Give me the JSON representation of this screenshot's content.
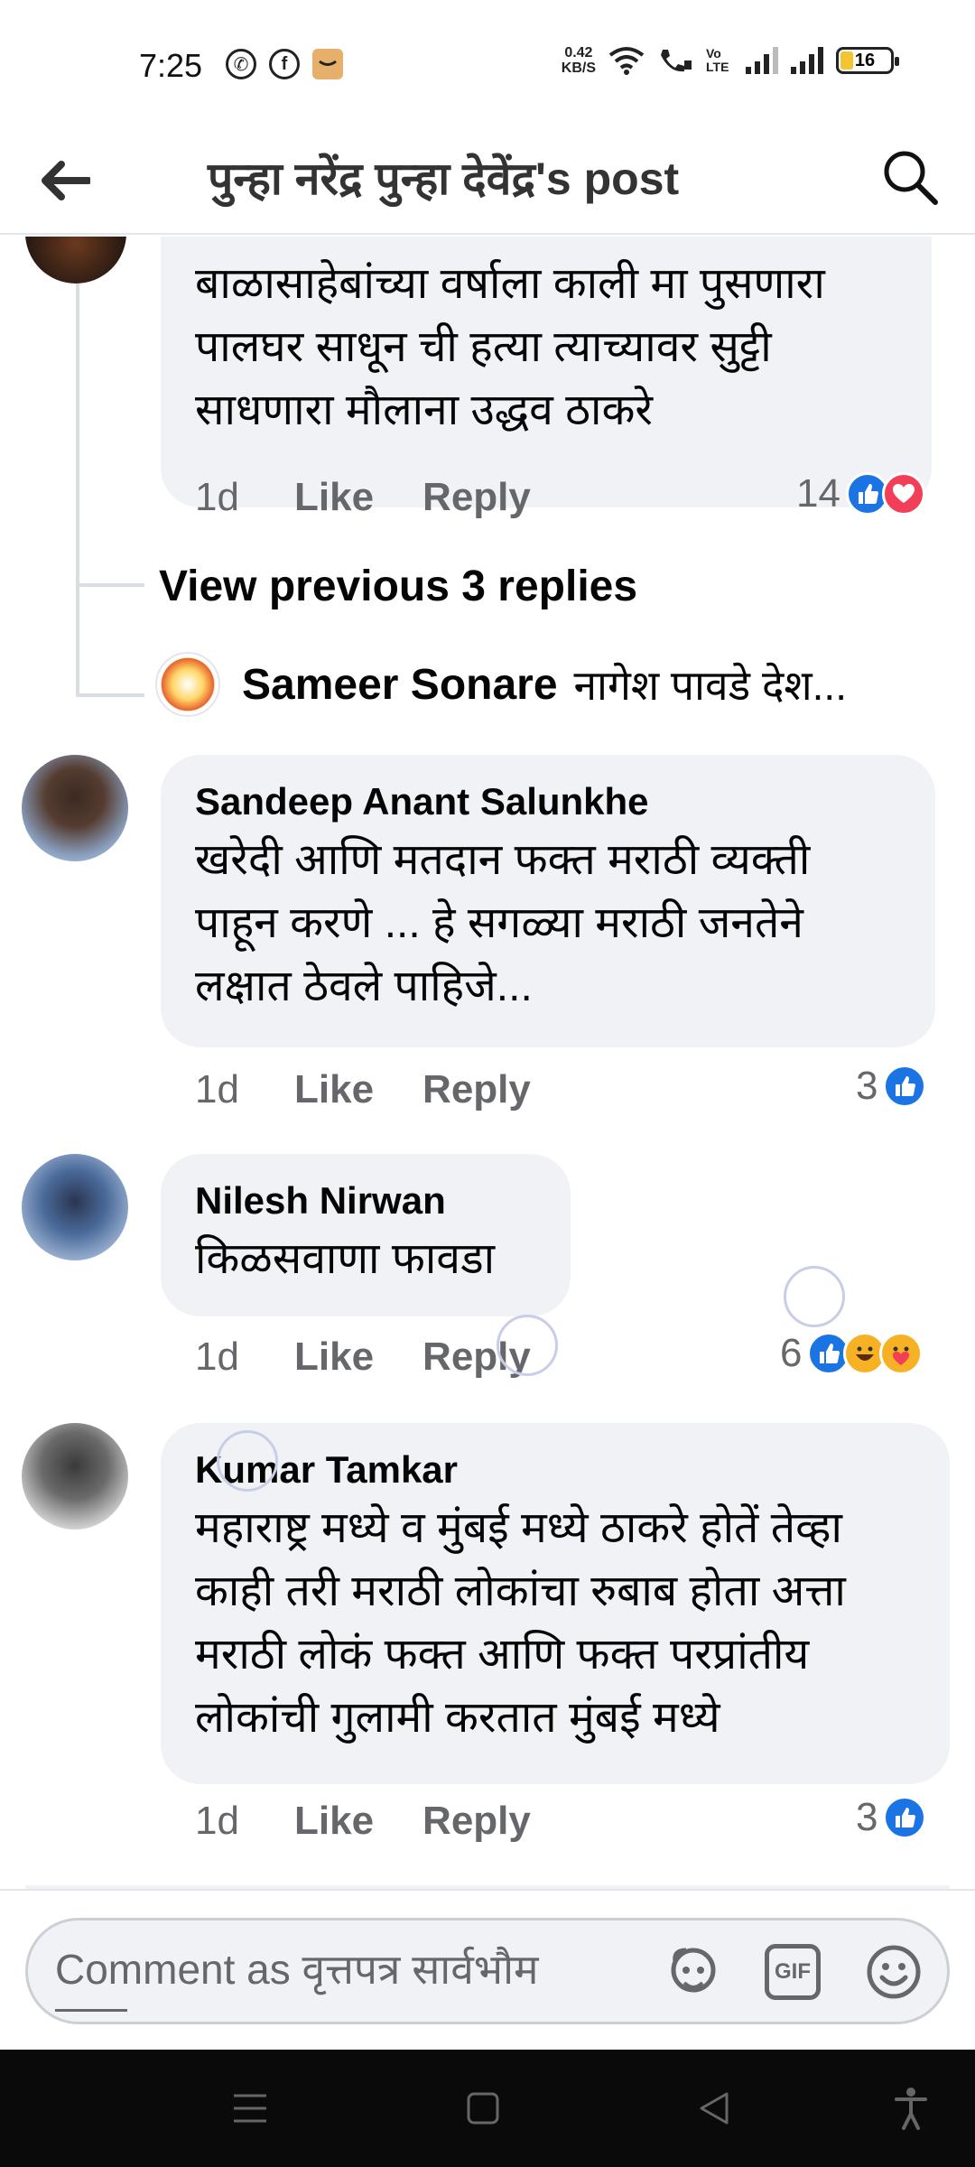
{
  "status_bar": {
    "time": "7:25",
    "app_icons": [
      "whatsapp-icon",
      "facebook-icon",
      "amazon-icon"
    ],
    "net_speed_value": "0.42",
    "net_speed_unit": "KB/S",
    "volte_label": "Vo LTE",
    "battery": "16"
  },
  "header": {
    "title": "पुन्हा नरेंद्र पुन्हा देवेंद्र's post"
  },
  "comments": [
    {
      "text": "बाळासाहेबांच्या वर्षाला काली मा पुसणारा पालघर साधून ची हत्या त्याच्यावर सुट्टी साधणारा मौलाना उद्धव ठाकरे",
      "time": "1d",
      "like_label": "Like",
      "reply_label": "Reply",
      "reaction_count": "14"
    },
    {
      "author": "Sandeep Anant Salunkhe",
      "text": "खरेदी आणि मतदान फक्त मराठी व्यक्ती पाहून करणे ... हे सगळ्या मराठी जनतेने लक्षात ठेवले पाहिजे...",
      "time": "1d",
      "like_label": "Like",
      "reply_label": "Reply",
      "reaction_count": "3"
    },
    {
      "author": "Nilesh Nirwan",
      "text": "किळसवाणा फावडा",
      "time": "1d",
      "like_label": "Like",
      "reply_label": "Reply",
      "reaction_count": "6"
    },
    {
      "author": "Kumar Tamkar",
      "text": "महाराष्ट्र मध्ये व मुंबई मध्ये ठाकरे होतें तेव्हा काही तरी मराठी लोकांचा रुबाब होता अत्ता मराठी लोकं फक्त आणि फक्त परप्रांतीय लोकांची गुलामी करतात मुंबई मध्ये",
      "time": "1d",
      "like_label": "Like",
      "reply_label": "Reply",
      "reaction_count": "3"
    }
  ],
  "replies_thread": {
    "view_previous": "View previous 3 replies",
    "reply_author": "Sameer Sonare",
    "reply_preview": "नागेश पावडे देश..."
  },
  "composer": {
    "placeholder": "Comment as वृत्तपत्र सार्वभौम",
    "gif_label": "GIF"
  },
  "colors": {
    "like_blue": "#1b74e4",
    "love_red": "#f33e58",
    "bubble_bg": "#f0f2f5",
    "meta_gray": "#65676b"
  }
}
